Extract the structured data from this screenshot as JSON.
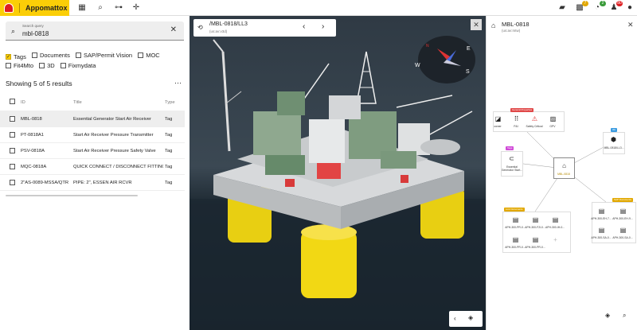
{
  "app": {
    "title": "Appomattox"
  },
  "topbar": {
    "badges": {
      "apps": "7",
      "tasks": "2",
      "alerts": "80"
    }
  },
  "search": {
    "label": "Search query",
    "value": "mbl-0818"
  },
  "filters": [
    {
      "label": "Tags",
      "checked": true
    },
    {
      "label": "Documents",
      "checked": false
    },
    {
      "label": "SAP/Permit Vision",
      "checked": false
    },
    {
      "label": "MOC",
      "checked": false
    },
    {
      "label": "Fit4Mto",
      "checked": false
    },
    {
      "label": "3D",
      "checked": false
    },
    {
      "label": "Fixmydata",
      "checked": false
    }
  ],
  "results": {
    "summary": "Showing 5 of 5 results",
    "columns": [
      "ID",
      "Title",
      "Type"
    ],
    "rows": [
      {
        "id": "MBL-0818",
        "title": "Essential Generator Start Air Receiver",
        "type": "Tag"
      },
      {
        "id": "PT-0818A1",
        "title": "Start Air Receiver Pressure Transmitter",
        "type": "Tag"
      },
      {
        "id": "PSV-0818A",
        "title": "Start Air Receiver Pressure Safety Valve",
        "type": "Tag"
      },
      {
        "id": "MQC-0818A",
        "title": "QUICK CONNECT / DISCONNECT FITTINGS",
        "type": "Tag"
      },
      {
        "id": "2\"AS-0089-MSSA/QTR",
        "title": "PIPE: 2\", ESSEN AIR RCVR",
        "type": "Tag"
      }
    ]
  },
  "viewer": {
    "path": "/MBL-0818/LL3",
    "sub": "(us:av:v3d)",
    "compass": {
      "n": "N",
      "e": "E",
      "w": "W",
      "s": "S"
    }
  },
  "graph": {
    "title": "MBL-0818",
    "sub": "(us:av:mtw)",
    "center_label": "MBL-0818",
    "groups": {
      "general": "General Properties",
      "tags": "Tags",
      "links": "Link Documents",
      "sap": "SAP Documents",
      "model": "3D"
    },
    "props": [
      "owner",
      "P&I",
      "Safety Critical",
      "GPV"
    ],
    "tag_node": "Essential Generator Start...",
    "model_node": "MBL-0818/LL3...",
    "link_docs": [
      "APH-300-PR-0...",
      "APH-300-F2l-0...",
      "APH-300-IH-0...",
      "APH-300-PR-0...",
      "APH-300-PR-0...",
      "APH-300-PR-0...",
      "APH-300-PR-0..."
    ],
    "sap_docs": [
      "APH-300-EH-7...",
      "APH-300-EH-9...",
      "APH-300-SA-0...",
      "APH-300-SA-0..."
    ]
  }
}
